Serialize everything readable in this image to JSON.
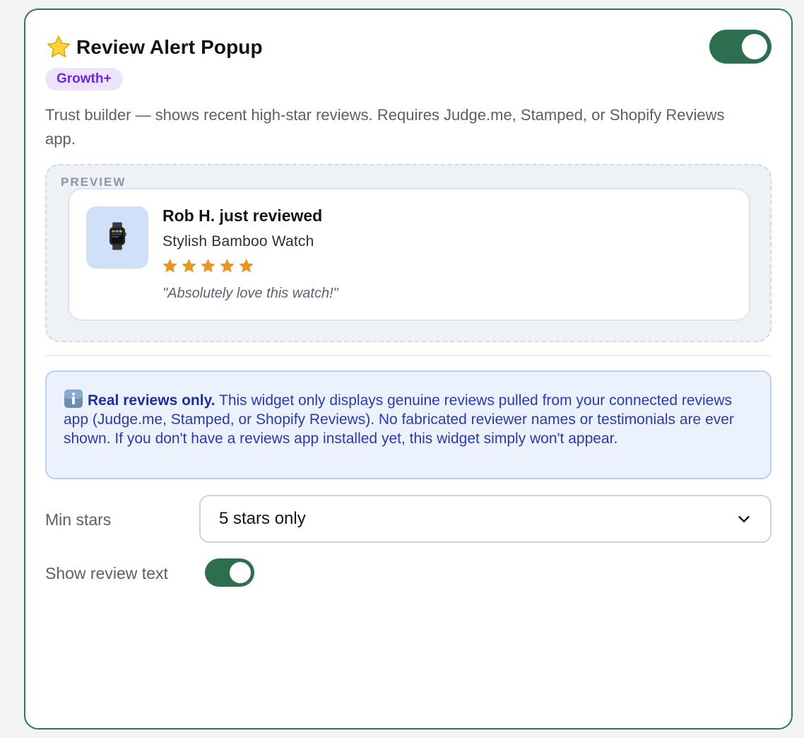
{
  "widget": {
    "title": "Review Alert Popup",
    "title_icon": "star-icon",
    "enabled": true,
    "plan_badge": "Growth+",
    "description": "Trust builder — shows recent high-star reviews. Requires Judge.me, Stamped, or Shopify Reviews app.",
    "accent_color": "#2e6e50",
    "badge_color": "#6d28d9"
  },
  "preview": {
    "label": "PREVIEW",
    "product_icon": "watch-icon",
    "reviewer_line": "Rob H. just reviewed",
    "product_name": "Stylish Bamboo Watch",
    "rating": 5,
    "rating_color": "#e8961e",
    "quote": "\"Absolutely love this watch!\""
  },
  "notice": {
    "icon": "info-icon",
    "heading": "Real reviews only.",
    "body": " This widget only displays genuine reviews pulled from your connected reviews app (Judge.me, Stamped, or Shopify Reviews). No fabricated reviewer names or testimonials are ever shown. If you don't have a reviews app installed yet, this widget simply won't appear."
  },
  "settings": {
    "min_stars_label": "Min stars",
    "min_stars_value": "5 stars only",
    "show_review_text_label": "Show review text",
    "show_review_text_enabled": true
  }
}
